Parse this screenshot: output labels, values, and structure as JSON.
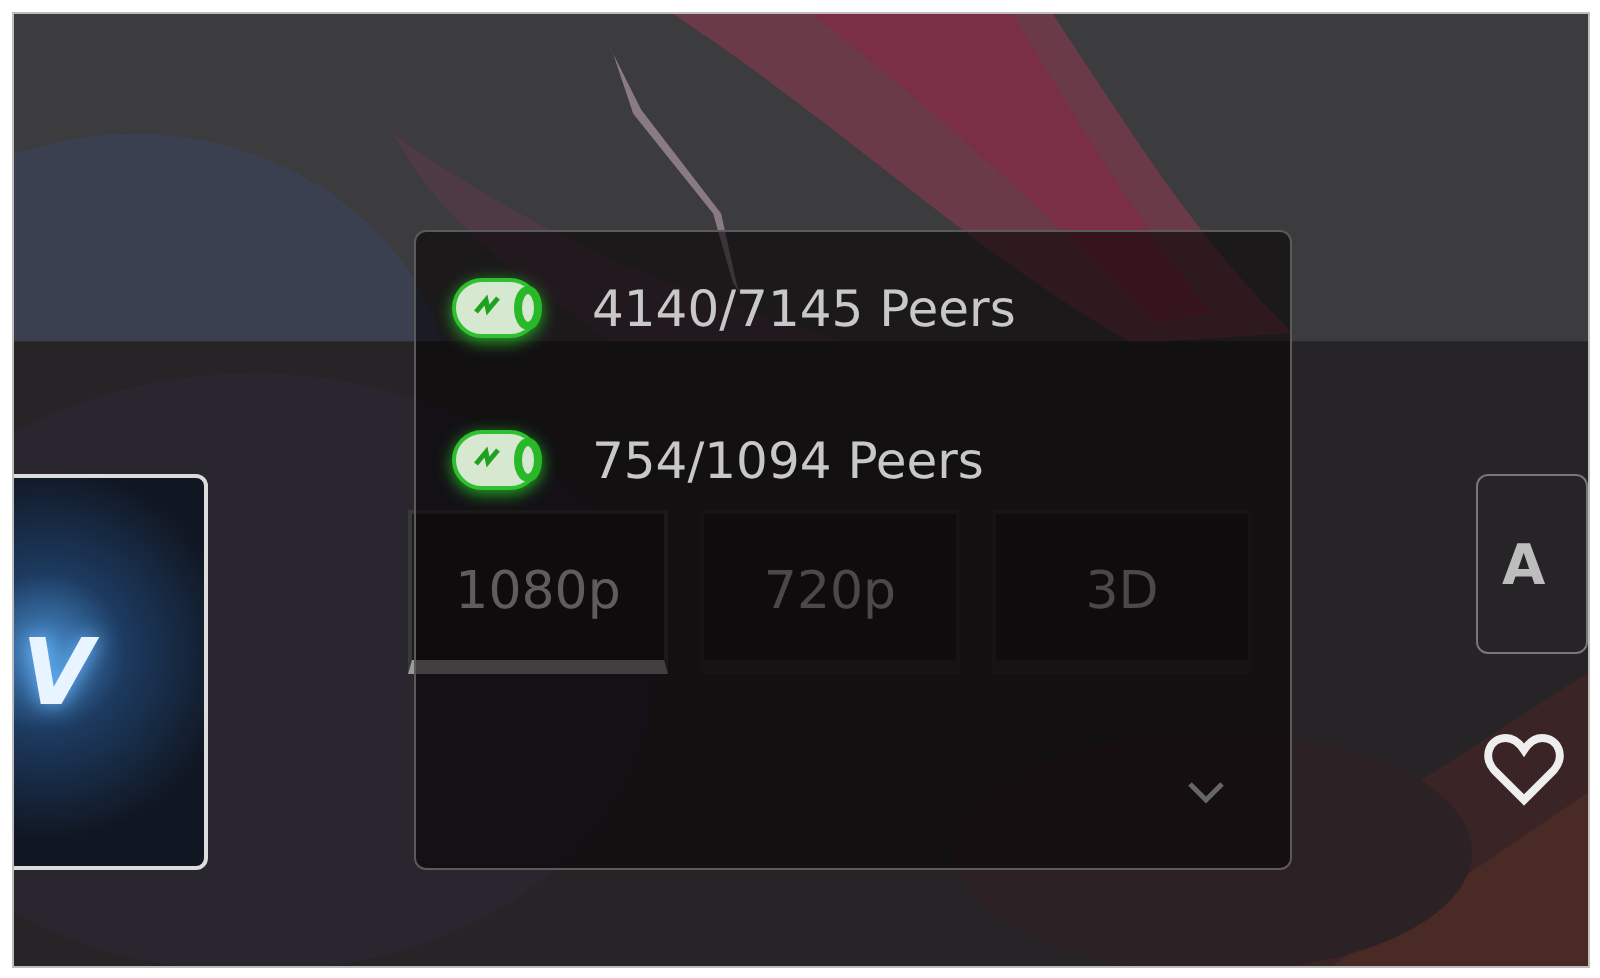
{
  "poster_card": {
    "text": "V"
  },
  "quality": [
    {
      "label": "1080p",
      "selected": true
    },
    {
      "label": "720p",
      "selected": false
    },
    {
      "label": "3D",
      "selected": false
    }
  ],
  "side_button": {
    "label": "A"
  },
  "peers_dropdown": {
    "items": [
      {
        "label": "4140/7145 Peers"
      },
      {
        "label": "754/1094 Peers"
      }
    ]
  }
}
